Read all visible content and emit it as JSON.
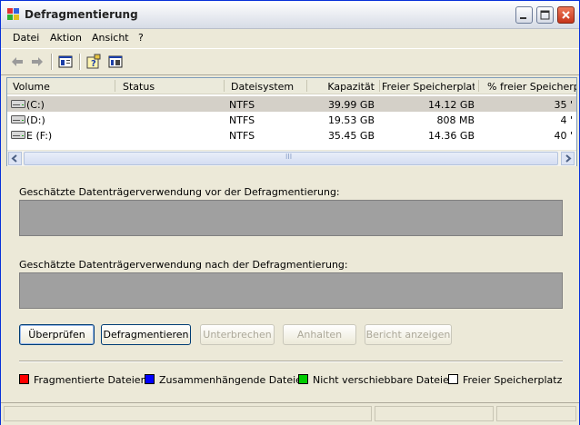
{
  "window": {
    "title": "Defragmentierung"
  },
  "menu": {
    "items": [
      "Datei",
      "Aktion",
      "Ansicht",
      "?"
    ]
  },
  "volumes": {
    "headers": [
      "Volume",
      "Status",
      "Dateisystem",
      "Kapazität",
      "Freier Speicherplatz",
      "% freier Speicherpla"
    ],
    "rows": [
      {
        "volume": "(C:)",
        "status": "",
        "fs": "NTFS",
        "capacity": "39.99 GB",
        "free": "14.12 GB",
        "pct": "35 '"
      },
      {
        "volume": "(D:)",
        "status": "",
        "fs": "NTFS",
        "capacity": "19.53 GB",
        "free": "808 MB",
        "pct": "4 '"
      },
      {
        "volume": "E (F:)",
        "status": "",
        "fs": "NTFS",
        "capacity": "35.45 GB",
        "free": "14.36 GB",
        "pct": "40 '"
      }
    ],
    "scroll_glyph": "III"
  },
  "labels": {
    "before": "Geschätzte Datenträgerverwendung vor der Defragmentierung:",
    "after": "Geschätzte Datenträgerverwendung nach der Defragmentierung:"
  },
  "buttons": {
    "check": "Überprüfen",
    "defrag": "Defragmentieren",
    "interrupt": "Unterbrechen",
    "stop": "Anhalten",
    "report": "Bericht anzeigen"
  },
  "legend": {
    "items": [
      {
        "label": "Fragmentierte Dateien",
        "color": "#ff0000"
      },
      {
        "label": "Zusammenhängende Dateien",
        "color": "#0000ff"
      },
      {
        "label": "Nicht verschiebbare Dateien",
        "color": "#00cc00"
      },
      {
        "label": "Freier Speicherplatz",
        "color": "#ffffff"
      }
    ]
  },
  "colors": {
    "bar_fill": "#a0a0a0",
    "selected_row": "#d4d0c8",
    "window_border": "#0831d9"
  }
}
